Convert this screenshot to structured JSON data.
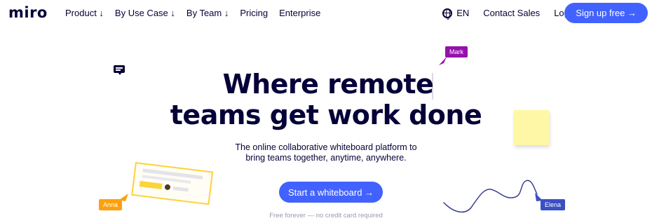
{
  "brand": {
    "logo_text": "miro",
    "accent_color": "#4262ff"
  },
  "nav": {
    "items": [
      "Product ↓",
      "By Use Case ↓",
      "By Team ↓",
      "Pricing",
      "Enterprise"
    ]
  },
  "header_right": {
    "language": "EN",
    "language_icon": "globe-icon",
    "contact_sales": "Contact Sales",
    "login": "Login",
    "signup": "Sign up free →"
  },
  "hero": {
    "title_line1": "Where remote",
    "title_line2": "teams get work done",
    "subtitle_line1": "The online collaborative whiteboard platform to",
    "subtitle_line2": "bring teams together, anytime, anywhere.",
    "cta": "Start a whiteboard →",
    "footnote": "Free forever — no credit card required"
  },
  "collaborators": {
    "mark": {
      "name": "Mark",
      "color": "#9510ac"
    },
    "anna": {
      "name": "Anna",
      "color": "#fca10f"
    },
    "elena": {
      "name": "Elena",
      "color": "#3b4fc4"
    }
  },
  "decor": {
    "sticky_color": "#fef7a6",
    "card_border_color": "#fcd33a",
    "chat_icon": "comment-icon"
  }
}
